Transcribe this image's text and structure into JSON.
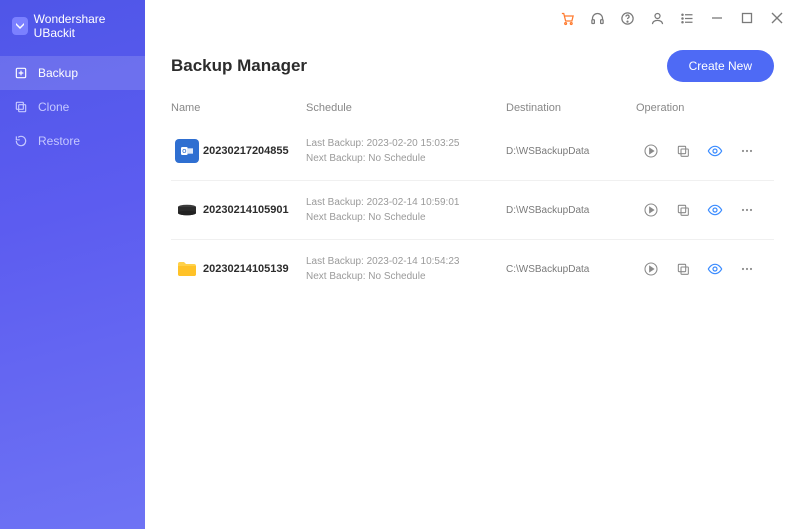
{
  "brand": {
    "name": "Wondershare UBackit"
  },
  "sidebar": {
    "items": [
      {
        "label": "Backup",
        "active": true
      },
      {
        "label": "Clone",
        "active": false
      },
      {
        "label": "Restore",
        "active": false
      }
    ]
  },
  "page": {
    "title": "Backup Manager",
    "create_button": "Create New"
  },
  "columns": {
    "name": "Name",
    "schedule": "Schedule",
    "destination": "Destination",
    "operation": "Operation"
  },
  "rows": [
    {
      "icon": "outlook",
      "name": "20230217204855",
      "last_backup": "Last Backup: 2023-02-20 15:03:25",
      "next_backup": "Next Backup: No Schedule",
      "destination": "D:\\WSBackupData"
    },
    {
      "icon": "disk",
      "name": "20230214105901",
      "last_backup": "Last Backup: 2023-02-14 10:59:01",
      "next_backup": "Next Backup: No Schedule",
      "destination": "D:\\WSBackupData"
    },
    {
      "icon": "folder",
      "name": "20230214105139",
      "last_backup": "Last Backup: 2023-02-14 10:54:23",
      "next_backup": "Next Backup: No Schedule",
      "destination": "C:\\WSBackupData"
    }
  ]
}
